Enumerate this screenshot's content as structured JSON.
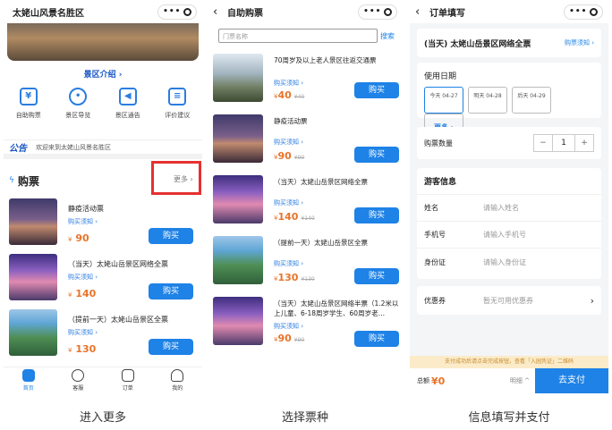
{
  "captions": [
    "进入更多",
    "选择票种",
    "信息填写并支付"
  ],
  "p1": {
    "title": "太姥山风景名胜区",
    "intro_label": "景区介绍 ›",
    "icons": [
      {
        "label": "自助购票",
        "icon": "ticket-icon"
      },
      {
        "label": "景区导览",
        "icon": "map-pin-icon"
      },
      {
        "label": "景区通告",
        "icon": "broadcast-icon"
      },
      {
        "label": "评价建议",
        "icon": "feedback-icon"
      }
    ],
    "notice_tag": "公告",
    "notice_text": "欢迎来到太姥山风景名胜区",
    "section_title": "购票",
    "more_label": "更多 ›",
    "tickets": [
      {
        "name": "静疫活动票",
        "note": "购买须知 ›",
        "currency": "¥",
        "price": "90",
        "buy": "购买"
      },
      {
        "name": "（当天）太姥山岳景区网络全票",
        "note": "购买须知 ›",
        "currency": "¥",
        "price": "140",
        "buy": "购买"
      },
      {
        "name": "（提前一天）太姥山岳景区全票",
        "note": "购买须知 ›",
        "currency": "¥",
        "price": "130",
        "buy": "购买"
      }
    ],
    "tabs": [
      "首页",
      "客服",
      "订单",
      "我的"
    ]
  },
  "p2": {
    "title": "自助购票",
    "search_placeholder": "门票名称",
    "search_btn": "搜索",
    "tickets": [
      {
        "name": "70周岁及以上老人景区往返交通票",
        "note": "购买须知 ›",
        "currency": "¥",
        "price": "40",
        "orig": "¥40",
        "buy": "购买"
      },
      {
        "name": "静疫活动票",
        "note": "购买须知 ›",
        "currency": "¥",
        "price": "90",
        "orig": "¥90",
        "buy": "购买"
      },
      {
        "name": "（当天）太姥山岳景区网络全票",
        "note": "购买须知 ›",
        "currency": "¥",
        "price": "140",
        "orig": "¥140",
        "buy": "购买"
      },
      {
        "name": "（提前一天）太姥山岳景区全票",
        "note": "购买须知 ›",
        "currency": "¥",
        "price": "130",
        "orig": "¥130",
        "buy": "购买"
      },
      {
        "name": "（当天）太姥山岳景区网络半票（1.2米以上儿童、6-18周岁学生、60周岁老…",
        "note": "购买须知 ›",
        "currency": "¥",
        "price": "90",
        "orig": "¥90",
        "buy": "购买"
      }
    ]
  },
  "p3": {
    "title": "订单填写",
    "ticket_name": "(当天) 太姥山岳景区网络全票",
    "ticket_note": "购票须知 ›",
    "date_label": "使用日期",
    "dates": [
      "今天 04-27",
      "明天 04-28",
      "后天 04-29"
    ],
    "date_more": "更多 ›",
    "qty_label": "购票数量",
    "qty": "1",
    "minus": "−",
    "plus": "+",
    "visitor_title": "游客信息",
    "fields": [
      {
        "label": "姓名",
        "placeholder": "请输入姓名"
      },
      {
        "label": "手机号",
        "placeholder": "请输入手机号"
      },
      {
        "label": "身份证",
        "placeholder": "请输入身份证"
      }
    ],
    "coupon_label": "优惠券",
    "coupon_value": "暂无可用优惠券",
    "tip": "支付成功后请点击完成按钮，查看「入园凭证」二维码",
    "total_label": "总额",
    "total_amount": "¥0",
    "detail_label": "明细 ^",
    "pay_btn": "去支付"
  },
  "colors": {
    "accent": "#1e82e6",
    "price": "#e8742a",
    "highlight": "#e53030"
  }
}
